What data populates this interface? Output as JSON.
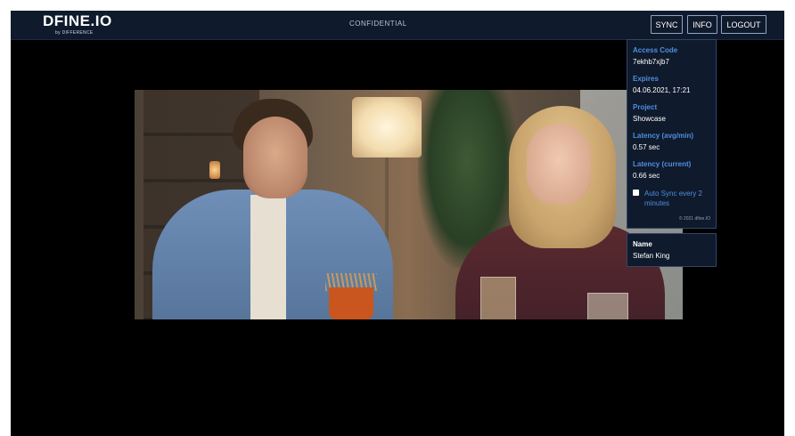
{
  "header": {
    "logo_text": "DFINE.IO",
    "logo_subtext": "by DIFFERENCE",
    "confidential_label": "CONFIDENTIAL",
    "buttons": {
      "sync": "SYNC",
      "info": "INFO",
      "logout": "LOGOUT"
    }
  },
  "info_panel": {
    "access_code_label": "Access Code",
    "access_code_value": "7ekhb7xjb7",
    "expires_label": "Expires",
    "expires_value": "04.06.2021, 17:21",
    "project_label": "Project",
    "project_value": "Showcase",
    "latency_avg_label": "Latency (avg/min)",
    "latency_avg_value": "0.57 sec",
    "latency_current_label": "Latency (current)",
    "latency_current_value": "0.66 sec",
    "auto_sync_label": "Auto Sync every 2 minutes",
    "copyright": "© 2021 dfine.IO"
  },
  "name_panel": {
    "label": "Name",
    "value": "Stefan King"
  },
  "colors": {
    "topbar_bg": "#0f1a2c",
    "accent_blue": "#4f8fe0",
    "button_border": "#8fa4c6"
  }
}
